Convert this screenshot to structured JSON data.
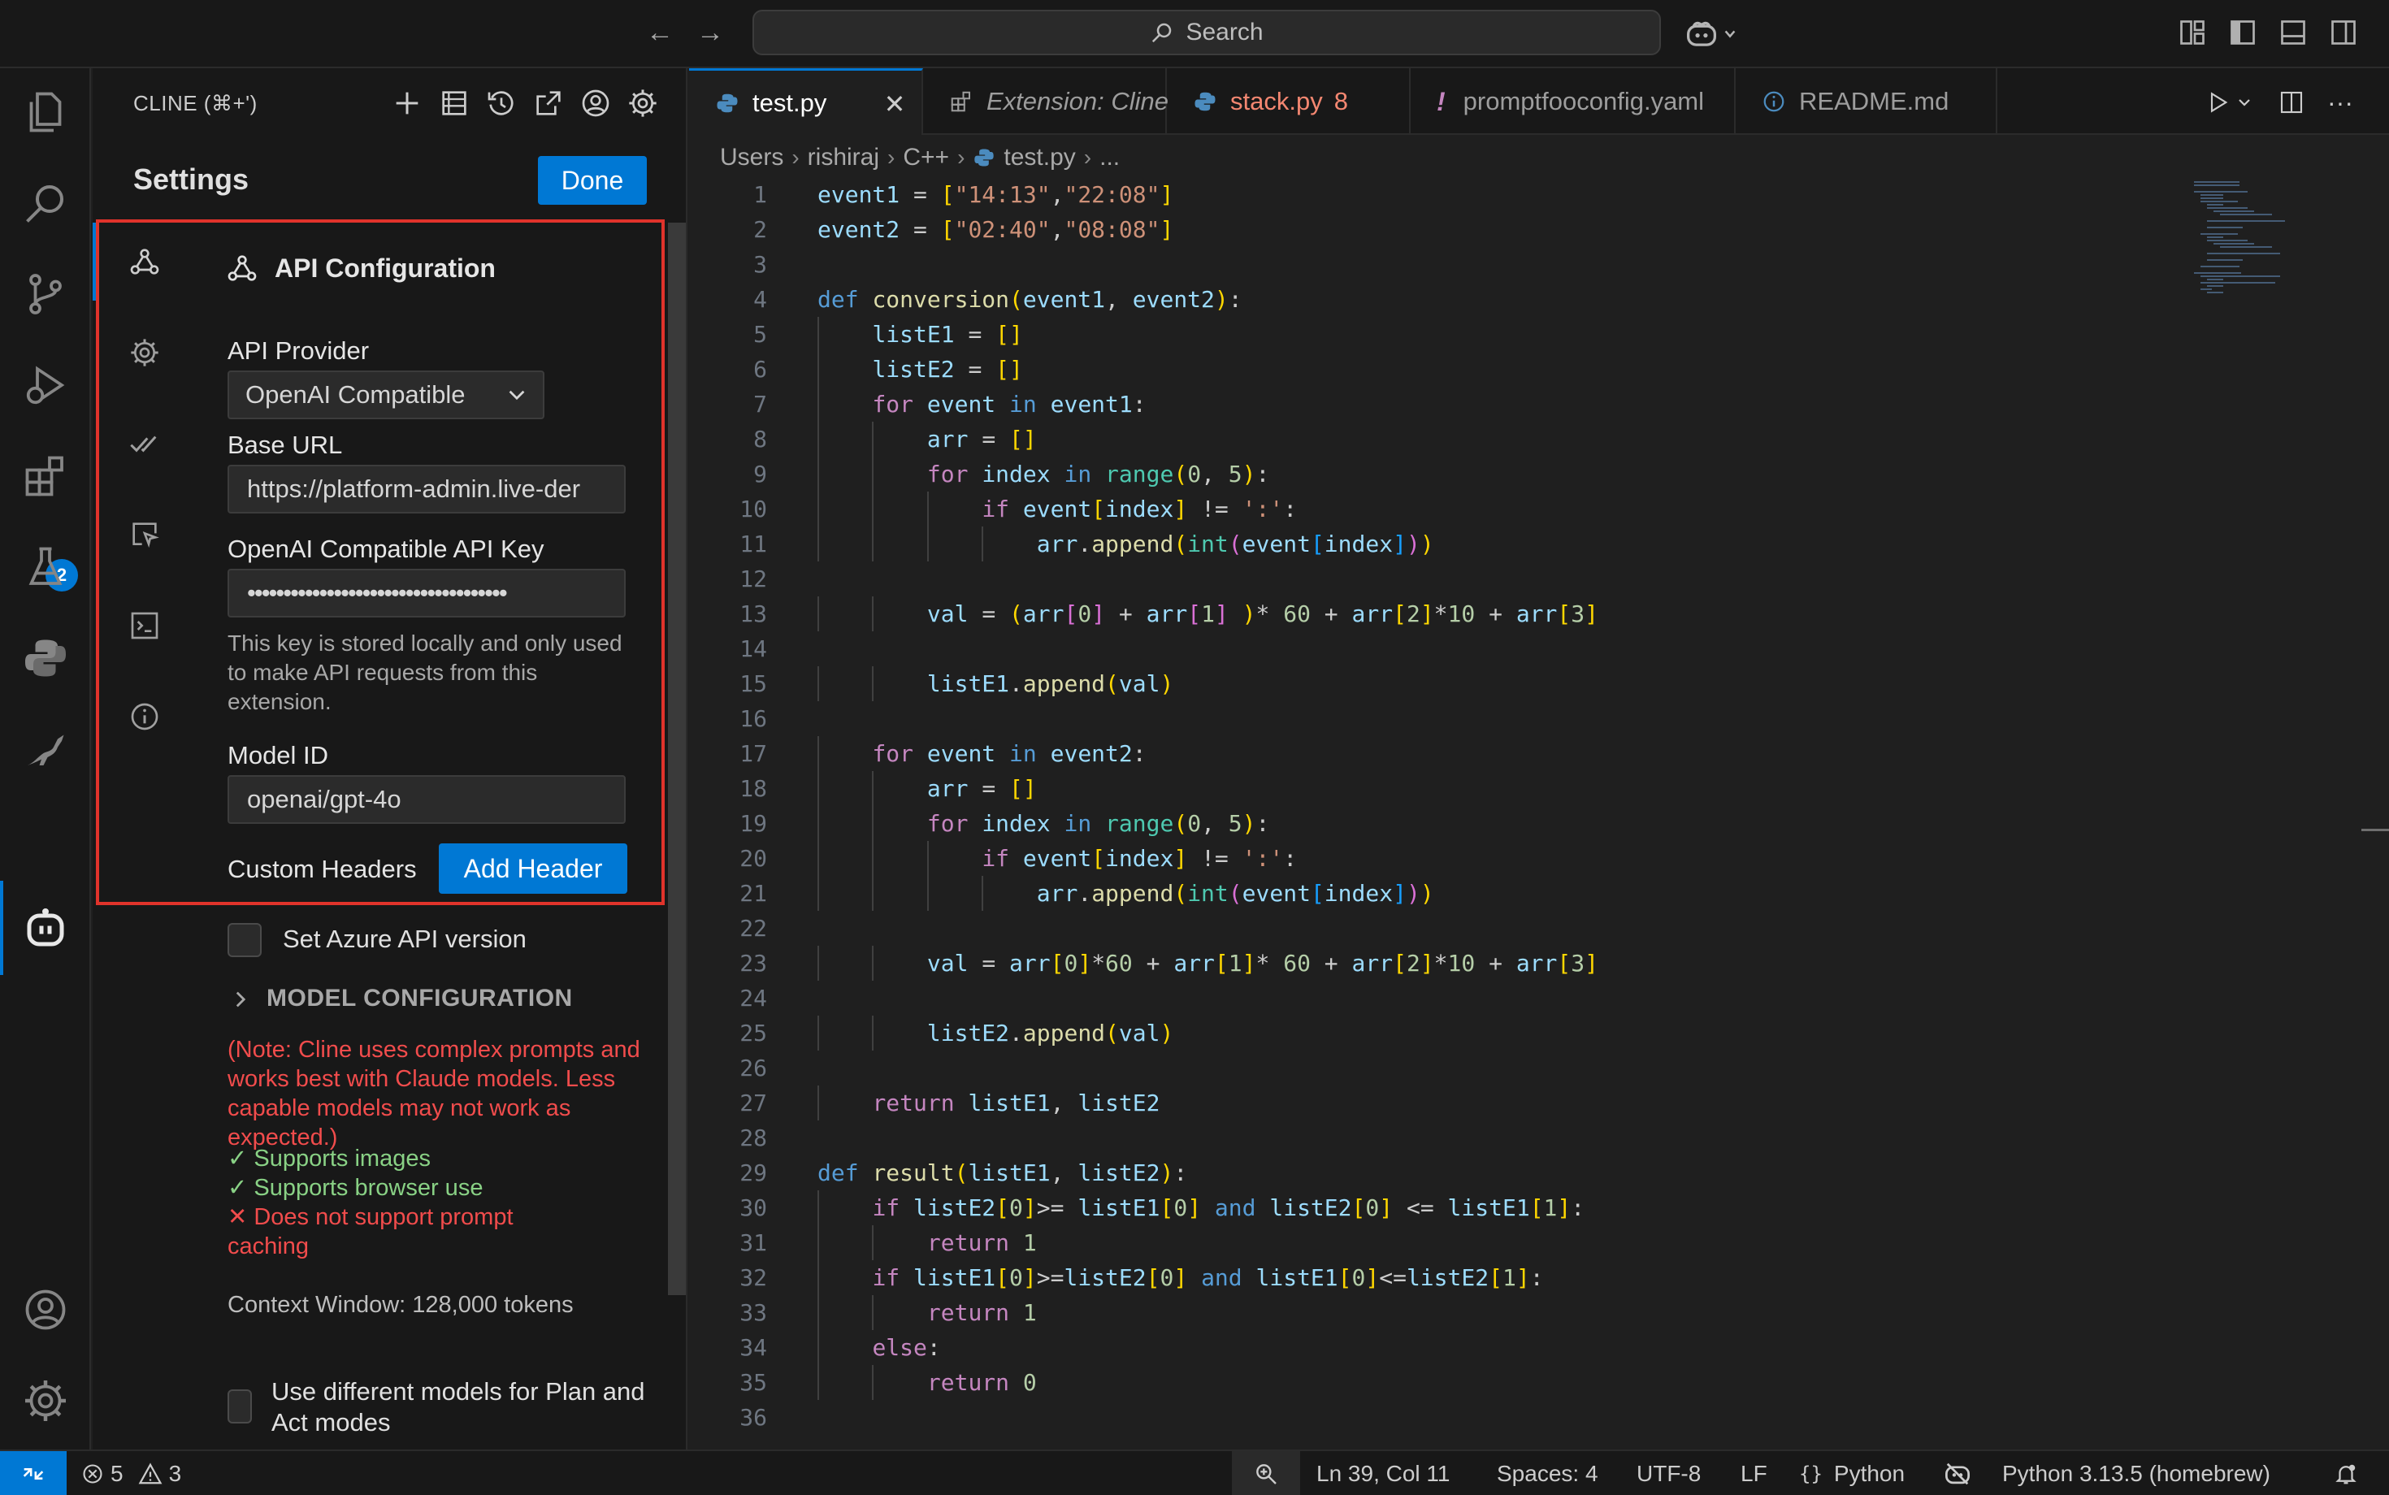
{
  "titlebar": {
    "search_placeholder": "Search",
    "icons": [
      "back-arrow-icon",
      "forward-arrow-icon",
      "search-icon",
      "copilot-icon",
      "customize-layout-icon",
      "toggle-primary-sidebar-icon",
      "toggle-panel-icon",
      "toggle-secondary-sidebar-icon"
    ]
  },
  "activitybar": {
    "items": [
      "explorer-icon",
      "search-icon",
      "source-control-icon",
      "run-debug-icon",
      "extensions-icon",
      "testing-icon",
      "python-icon",
      "kangaroo-icon",
      "cline-icon"
    ],
    "extensions_badge": "2",
    "bottom_items": [
      "accounts-icon",
      "manage-gear-icon"
    ]
  },
  "cline": {
    "title": "CLINE (⌘+')",
    "toolbar_icons": [
      "plus-icon",
      "mcp-servers-icon",
      "history-icon",
      "popout-icon",
      "account-icon",
      "settings-gear-icon"
    ],
    "settings_heading": "Settings",
    "done_label": "Done",
    "section_title": "API Configuration",
    "nav_icons": [
      "webhook-icon",
      "gear-icon",
      "check-all-icon",
      "browser-cursor-icon",
      "terminal-icon",
      "info-icon"
    ],
    "provider_label": "API Provider",
    "provider_value": "OpenAI Compatible",
    "base_url_label": "Base URL",
    "base_url_value": "https://platform-admin.live-der",
    "api_key_label": "OpenAI Compatible API Key",
    "api_key_value": "••••••••••••••••••••••••••••••••••••",
    "api_key_note": "This key is stored locally and only used to make API requests from this extension.",
    "model_id_label": "Model ID",
    "model_id_value": "openai/gpt-4o",
    "custom_headers_label": "Custom Headers",
    "add_header_label": "Add Header",
    "azure_label": "Set Azure API version",
    "model_config_heading": "MODEL CONFIGURATION",
    "note": "(Note: Cline uses complex prompts and works best with Claude models. Less capable models may not work as expected.)",
    "capabilities": [
      {
        "mark": "✓",
        "text": "Supports images",
        "ok": true
      },
      {
        "mark": "✓",
        "text": "Supports browser use",
        "ok": true
      },
      {
        "mark": "✕",
        "text": "Does not support prompt caching",
        "ok": false
      }
    ],
    "context_window": "Context Window: 128,000 tokens",
    "plan_act_label": "Use different models for Plan and Act modes",
    "colors": {
      "accent": "#0078d4",
      "highlight": "#e0332b",
      "error": "#f14c4c",
      "success": "#89d185"
    }
  },
  "tabs": [
    {
      "label": "test.py",
      "icon": "python-file-icon",
      "active": true,
      "badge": ""
    },
    {
      "label": "Extension: Cline",
      "icon": "extension-preview-icon",
      "active": false,
      "badge": ""
    },
    {
      "label": "stack.py",
      "icon": "python-file-icon",
      "active": false,
      "badge": "8"
    },
    {
      "label": "promptfooconfig.yaml",
      "icon": "yaml-warning-icon",
      "active": false,
      "badge": ""
    },
    {
      "label": "README.md",
      "icon": "info-icon",
      "active": false,
      "badge": ""
    }
  ],
  "editor_actions": [
    "run-icon",
    "run-dropdown-icon",
    "split-editor-icon",
    "more-actions-icon"
  ],
  "breadcrumb": [
    "Users",
    "rishiraj",
    "C++",
    "test.py",
    "..."
  ],
  "code_lines": [
    "event1 = [\"14:13\",\"22:08\"]",
    "event2 = [\"02:40\",\"08:08\"]",
    "",
    "def conversion(event1, event2):",
    "    listE1 = []",
    "    listE2 = []",
    "    for event in event1:",
    "        arr = []",
    "        for index in range(0, 5):",
    "            if event[index] != ':':",
    "                arr.append(int(event[index]))",
    "",
    "        val = (arr[0] + arr[1] )* 60 + arr[2]*10 + arr[3]",
    "",
    "        listE1.append(val)",
    "",
    "    for event in event2:",
    "        arr = []",
    "        for index in range(0, 5):",
    "            if event[index] != ':':",
    "                arr.append(int(event[index]))",
    "",
    "        val = arr[0]*60 + arr[1]* 60 + arr[2]*10 + arr[3]",
    "",
    "        listE2.append(val)",
    "",
    "    return listE1, listE2",
    "",
    "def result(listE1, listE2):",
    "    if listE2[0]>= listE1[0] and listE2[0] <= listE1[1]:",
    "        return 1",
    "    if listE1[0]>=listE2[0] and listE1[0]<=listE2[1]:",
    "        return 1",
    "    else:",
    "        return 0",
    ""
  ],
  "statusbar": {
    "errors": "5",
    "warnings": "3",
    "cursor": "Ln 39, Col 11",
    "spaces": "Spaces: 4",
    "encoding": "UTF-8",
    "eol": "LF",
    "language": "Python",
    "interpreter": "Python 3.13.5 (homebrew)"
  }
}
